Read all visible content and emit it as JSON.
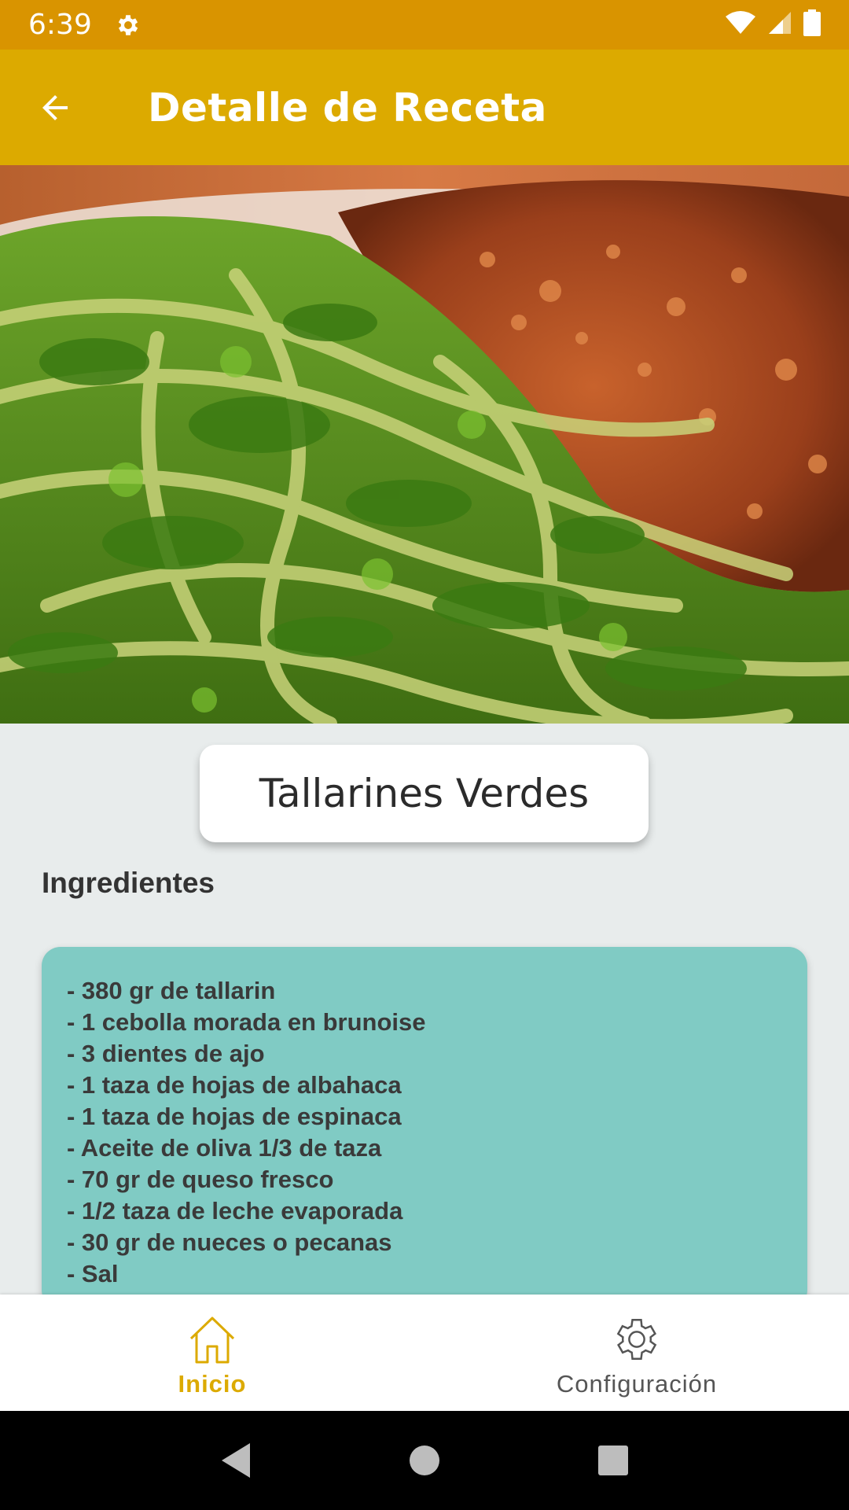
{
  "status_bar": {
    "time": "6:39"
  },
  "app_bar": {
    "title": "Detalle de Receta"
  },
  "recipe": {
    "title": "Tallarines Verdes",
    "ingredients_heading": "Ingredientes",
    "ingredients": [
      "- 380 gr de tallarin",
      "- 1 cebolla morada en brunoise",
      "- 3 dientes de ajo",
      "- 1 taza de hojas de albahaca",
      "- 1 taza de hojas de espinaca",
      "- Aceite de oliva 1/3 de taza",
      "- 70 gr de queso fresco",
      "- 1/2 taza de leche evaporada",
      "- 30 gr de nueces o pecanas",
      "- Sal"
    ]
  },
  "bottom_nav": {
    "items": [
      {
        "label": "Inicio",
        "icon": "home-icon",
        "active": true
      },
      {
        "label": "Configuración",
        "icon": "gear-icon",
        "active": false
      }
    ]
  },
  "colors": {
    "status_bar": "#d99400",
    "app_bar": "#dcaa00",
    "accent": "#dcaa00",
    "ingredients_card": "#80cbc4"
  }
}
